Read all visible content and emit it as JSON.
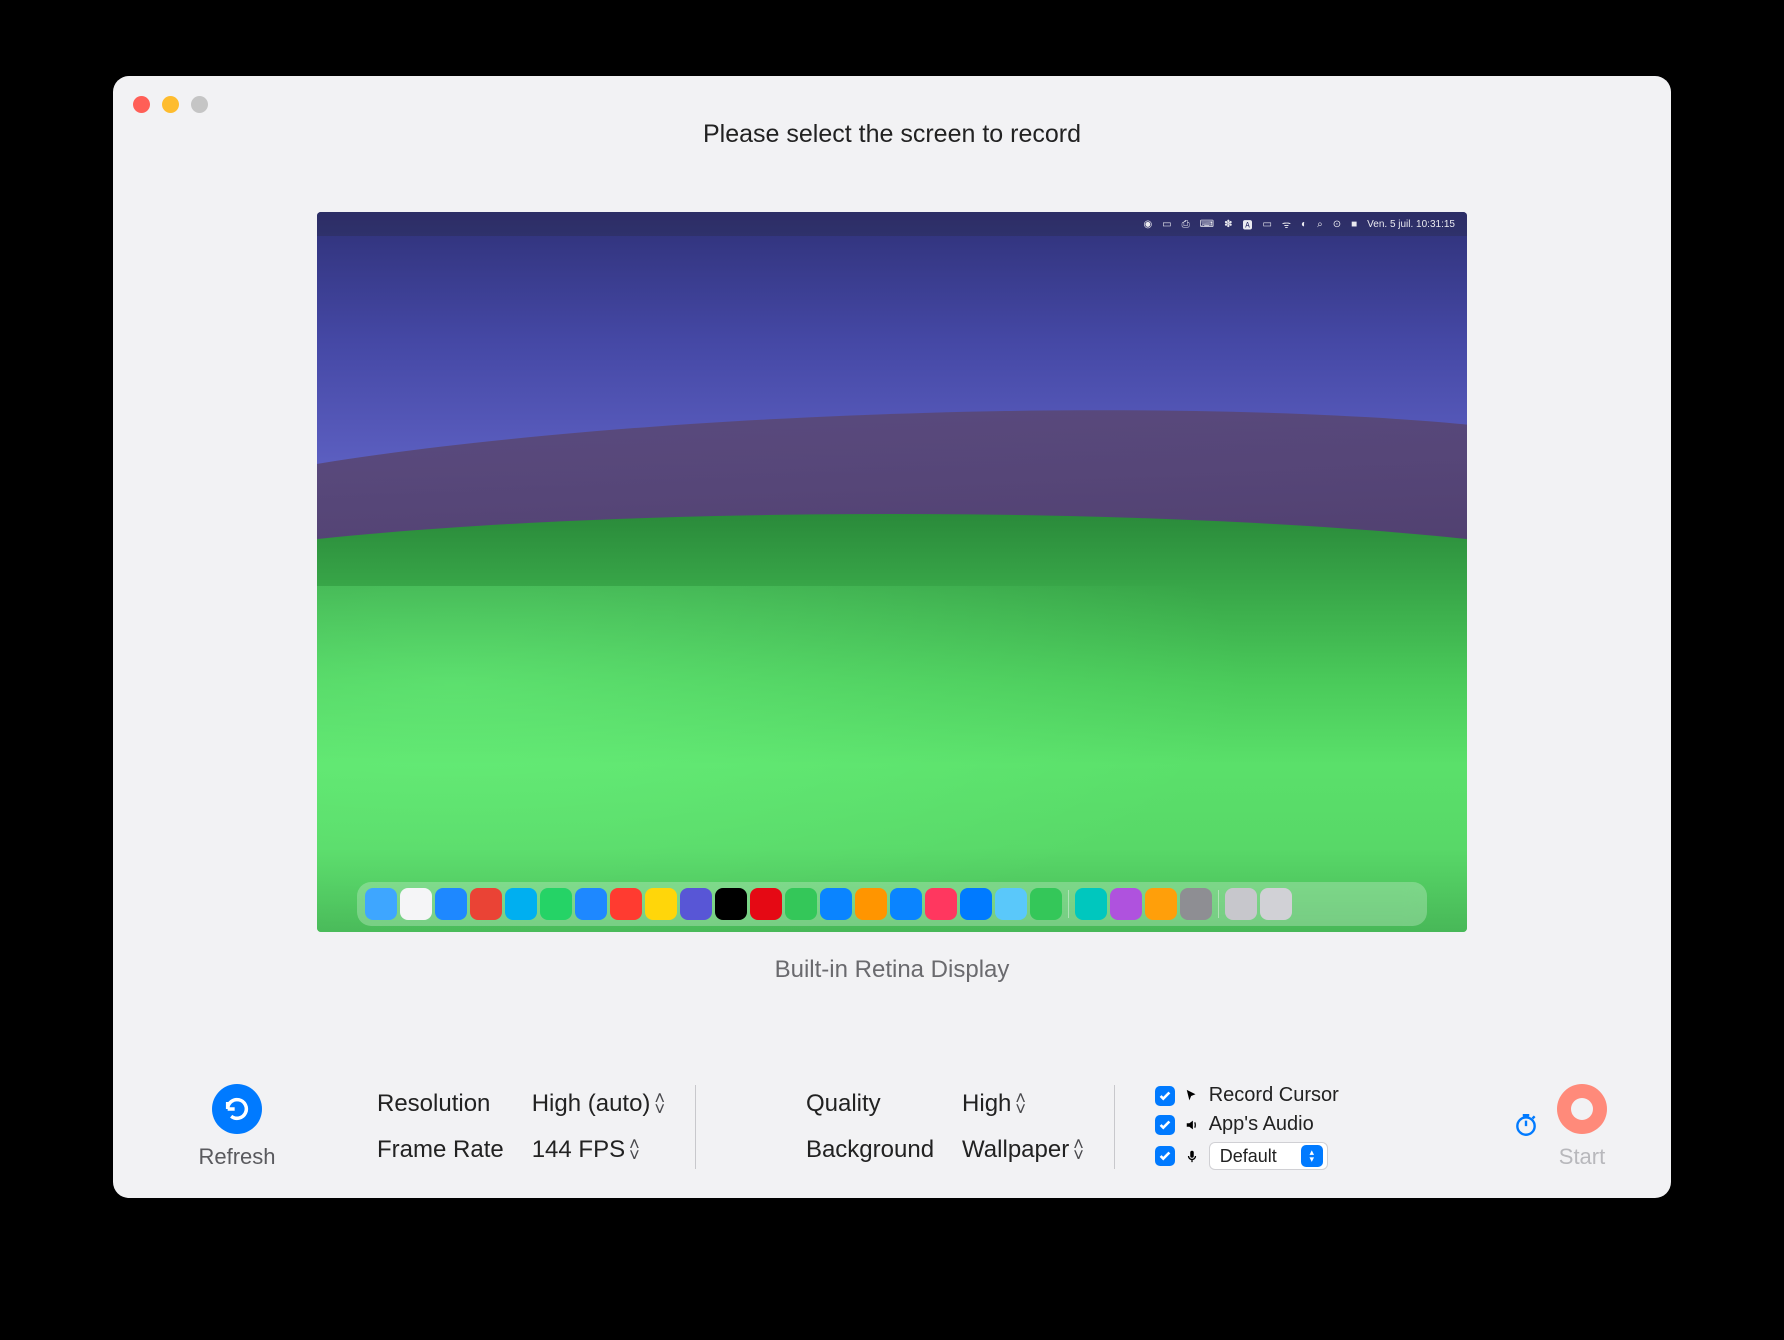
{
  "title": "Please select the screen to record",
  "display_name": "Built-in Retina Display",
  "menubar": {
    "date_time": "Ven. 5 juil.  10:31:15"
  },
  "refresh": {
    "label": "Refresh"
  },
  "settings": {
    "resolution": {
      "label": "Resolution",
      "value": "High (auto)"
    },
    "frame_rate": {
      "label": "Frame Rate",
      "value": "144 FPS"
    },
    "quality": {
      "label": "Quality",
      "value": "High"
    },
    "background": {
      "label": "Background",
      "value": "Wallpaper"
    }
  },
  "checks": {
    "record_cursor": {
      "label": "Record Cursor",
      "checked": true
    },
    "apps_audio": {
      "label": "App's Audio",
      "checked": true
    },
    "microphone": {
      "checked": true,
      "selected": "Default"
    }
  },
  "start": {
    "label": "Start"
  },
  "dock_colors": [
    "#3ea6ff",
    "#f5f5f7",
    "#1e88ff",
    "#ea4335",
    "#00aff0",
    "#25d366",
    "#1e88ff",
    "#ff3b30",
    "#ffd60a",
    "#5856d6",
    "#000",
    "#e50914",
    "#34c759",
    "#0a84ff",
    "#ff9500",
    "#0a84ff",
    "#ff375f",
    "#007aff",
    "#5ac8fa",
    "#34c759",
    "#00c7be",
    "#af52de",
    "#ff9f0a",
    "#8e8e93",
    "#c7c7cc",
    "#d1d1d6"
  ]
}
